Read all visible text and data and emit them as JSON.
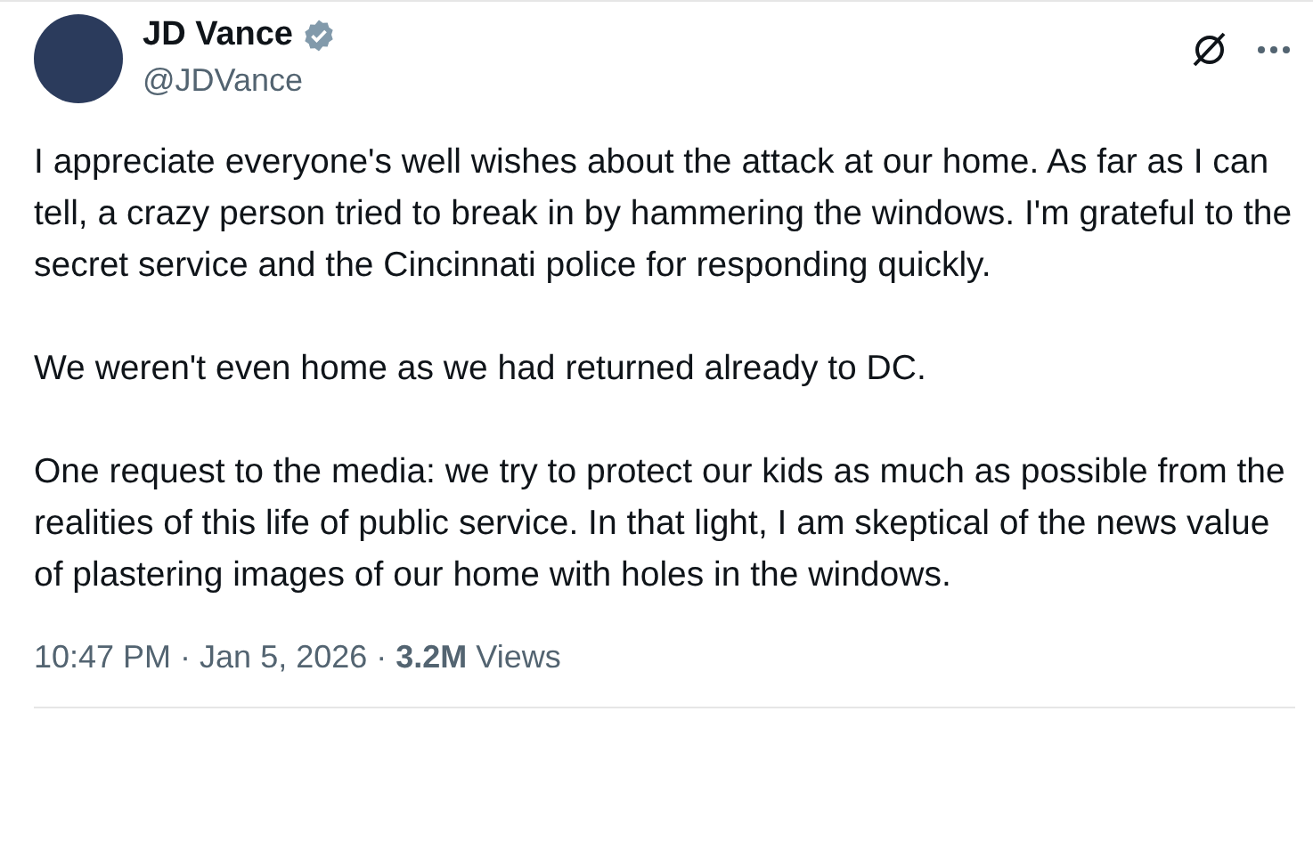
{
  "author": {
    "name": "JD Vance",
    "handle": "@JDVance",
    "verified": true
  },
  "paragraphs": [
    "I appreciate everyone's well wishes about the attack at our home. As far as I can tell, a crazy person tried to break in by hammering the windows. I'm grateful to the secret service and the Cincinnati police for responding quickly.",
    "We weren't even home as we had returned already to DC.",
    "One request to the media: we try to protect our kids as much as possible from the realities of this life of public service. In that light, I am skeptical of the news value of plastering images of our home with holes in the windows."
  ],
  "meta": "10:47 PM · Jan 5, 2026 · **3.2M** Views"
}
